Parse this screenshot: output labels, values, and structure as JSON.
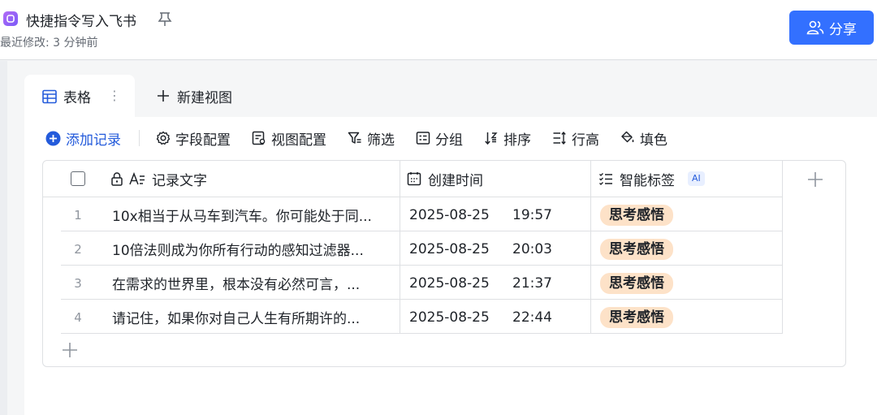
{
  "header": {
    "title": "快捷指令写入飞书",
    "modified": "最近修改: 3 分钟前",
    "share_label": "分享"
  },
  "tabs": {
    "active_label": "表格",
    "more_glyph": "⋮",
    "new_view_label": "新建视图"
  },
  "toolbar": {
    "add_record": "添加记录",
    "field_config": "字段配置",
    "view_config": "视图配置",
    "filter": "筛选",
    "group": "分组",
    "sort": "排序",
    "row_height": "行高",
    "fill_color": "填色"
  },
  "table": {
    "columns": {
      "text": "记录文字",
      "created": "创建时间",
      "tags": "智能标签",
      "ai_badge": "AI"
    },
    "rows": [
      {
        "num": "1",
        "text": "10x相当于从马车到汽车。你可能处于同...",
        "date": "2025-08-25",
        "time": "19:57",
        "tag": "思考感悟"
      },
      {
        "num": "2",
        "text": "10倍法则成为你所有行动的感知过滤器...",
        "date": "2025-08-25",
        "time": "20:03",
        "tag": "思考感悟"
      },
      {
        "num": "3",
        "text": "在需求的世界里，根本没有必然可言，...",
        "date": "2025-08-25",
        "time": "21:37",
        "tag": "思考感悟"
      },
      {
        "num": "4",
        "text": "请记住，如果你对自己人生有所期许的...",
        "date": "2025-08-25",
        "time": "22:44",
        "tag": "思考感悟"
      }
    ]
  },
  "colors": {
    "accent": "#3370ff",
    "link": "#245bdb",
    "tag_bg": "#fde2c8",
    "border": "#dee0e3"
  }
}
